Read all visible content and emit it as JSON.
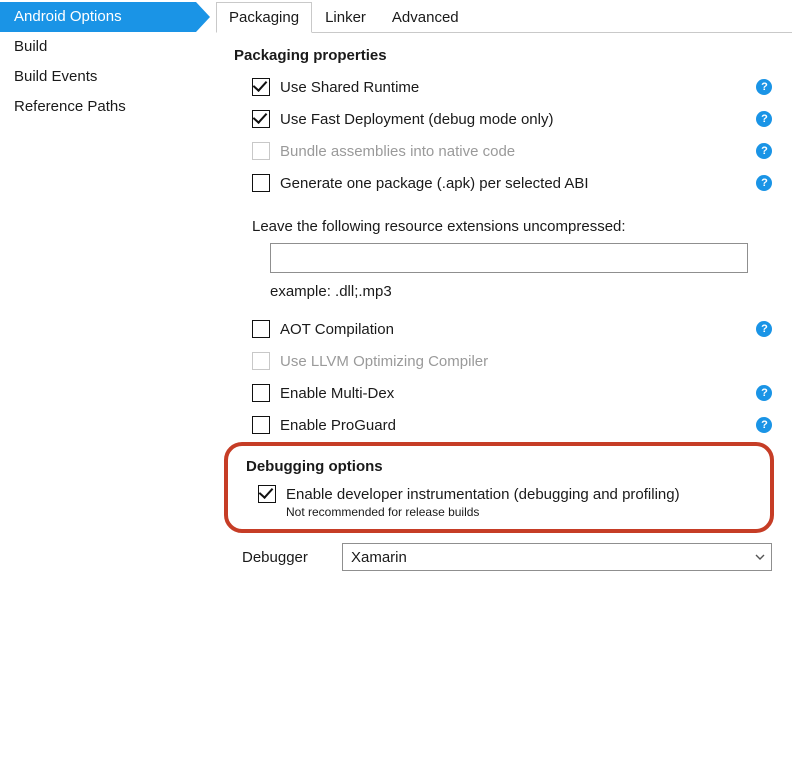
{
  "sidebar": {
    "items": [
      {
        "label": "Android Options",
        "selected": true
      },
      {
        "label": "Build",
        "selected": false
      },
      {
        "label": "Build Events",
        "selected": false
      },
      {
        "label": "Reference Paths",
        "selected": false
      }
    ]
  },
  "tabs": [
    {
      "label": "Packaging",
      "active": true
    },
    {
      "label": "Linker",
      "active": false
    },
    {
      "label": "Advanced",
      "active": false
    }
  ],
  "packaging": {
    "heading": "Packaging properties",
    "rows": {
      "shared_runtime": "Use Shared Runtime",
      "fast_deploy": "Use Fast Deployment (debug mode only)",
      "bundle_native": "Bundle assemblies into native code",
      "one_apk_per_abi": "Generate one package (.apk) per selected ABI"
    },
    "uncompressed_label": "Leave the following resource extensions uncompressed:",
    "uncompressed_value": "",
    "uncompressed_example": "example: .dll;.mp3",
    "aot": "AOT Compilation",
    "llvm": "Use LLVM Optimizing Compiler",
    "multidex": "Enable Multi-Dex",
    "proguard": "Enable ProGuard"
  },
  "debugging": {
    "heading": "Debugging options",
    "enable_dev_instr": "Enable developer instrumentation (debugging and profiling)",
    "not_recommended": "Not recommended for release builds",
    "debugger_label": "Debugger",
    "debugger_value": "Xamarin"
  },
  "help_glyph": "?"
}
